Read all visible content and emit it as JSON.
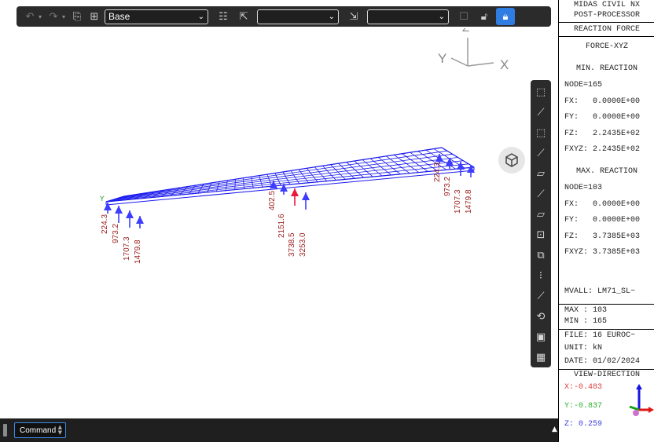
{
  "toolbar": {
    "select1": {
      "value": "Base"
    },
    "select2": {
      "value": ""
    },
    "select3": {
      "value": ""
    },
    "icons": [
      "undo-icon",
      "redo-icon",
      "export-icon",
      "group-icon",
      "structure-icon",
      "select-icon",
      "filter-icon",
      "comment-icon",
      "lock-icon",
      "lock-active-icon"
    ]
  },
  "viewport": {
    "axes": {
      "z": "Z",
      "y": "Y",
      "x": "X"
    },
    "labels": {
      "n1": "224.3",
      "n2": "973.2",
      "n3": "1707.3",
      "n4": "1479.8",
      "n5": "402.5",
      "n6": "2151.6",
      "n7": "3738.5",
      "n8": "3253.0",
      "n9": "224.3",
      "n10": "973.2",
      "n11": "1707.3",
      "n12": "1479.8"
    },
    "colors": {
      "mesh": "#1a1aee",
      "arrow": "#3d3dff",
      "arrow_max": "#e8193a",
      "label": "#9a1b1b"
    }
  },
  "command": {
    "label": "Command"
  },
  "panel": {
    "title1": "MIDAS CIVIL NX",
    "title2": "POST-PROCESSOR",
    "title3": "REACTION FORCE",
    "component": "FORCE-XYZ",
    "min_header": "MIN. REACTION",
    "min_node": "NODE=165",
    "min_fx": "FX:   0.0000E+00",
    "min_fy": "FY:   0.0000E+00",
    "min_fz": "FZ:   2.2435E+02",
    "min_fxyz": "FXYZ: 2.2435E+02",
    "max_header": "MAX. REACTION",
    "max_node": "NODE=103",
    "max_fx": "FX:   0.0000E+00",
    "max_fy": "FY:   0.0000E+00",
    "max_fz": "FZ:   3.7385E+03",
    "max_fxyz": "FXYZ: 3.7385E+03",
    "mvall": "MVALL: LM71_SL~",
    "max": "MAX : 103",
    "min": "MIN : 165",
    "file": "FILE: 16 EUROC~",
    "unit": "UNIT: kN",
    "date": "DATE: 01/02/2024",
    "view_header": "VIEW-DIRECTION",
    "view_x": "X:-0.483",
    "view_y": "Y:-0.837",
    "view_z": "Z: 0.259"
  }
}
